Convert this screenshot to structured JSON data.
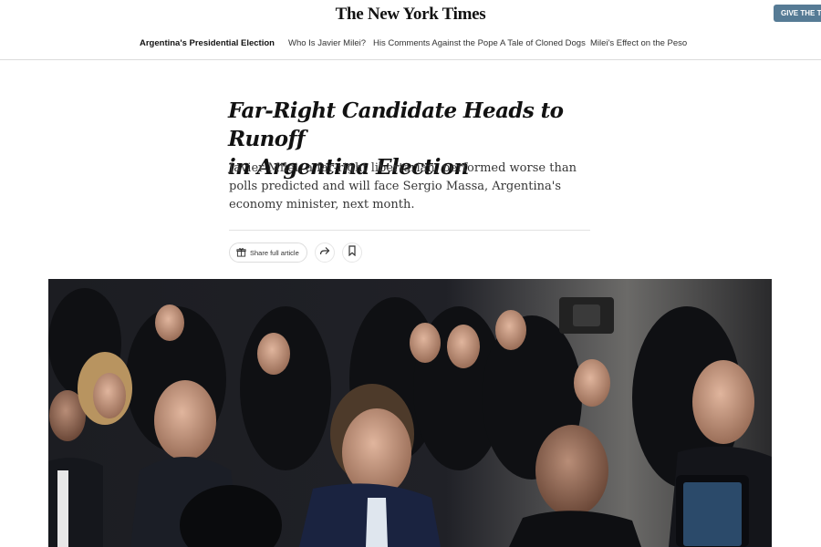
{
  "masthead": {
    "logo": "The New York Times",
    "cta_label": "GIVE THE TIMES"
  },
  "nav": {
    "items": [
      {
        "label": "Argentina's Presidential Election",
        "active": true
      },
      {
        "label": "Who Is Javier Milei?",
        "active": false
      },
      {
        "label": "His Comments Against the Pope",
        "active": false
      },
      {
        "label": "A Tale of Cloned Dogs",
        "active": false
      },
      {
        "label": "Milei's Effect on the Peso",
        "active": false
      }
    ]
  },
  "article": {
    "headline_line1": "Far-Right Candidate Heads to Runoff",
    "headline_line2": "in Argentina Election",
    "summary": "Javier Milei, a far-right libertarian, performed worse than polls predicted and will face Sergio Massa, Argentina's economy minister, next month.",
    "share_label": "Share full article"
  },
  "icons": {
    "share": "gift-icon",
    "forward": "share-arrow-icon",
    "save": "bookmark-icon"
  },
  "colors": {
    "cta_background": "#567b95",
    "text": "#121212",
    "photo_background": "#15161a"
  }
}
